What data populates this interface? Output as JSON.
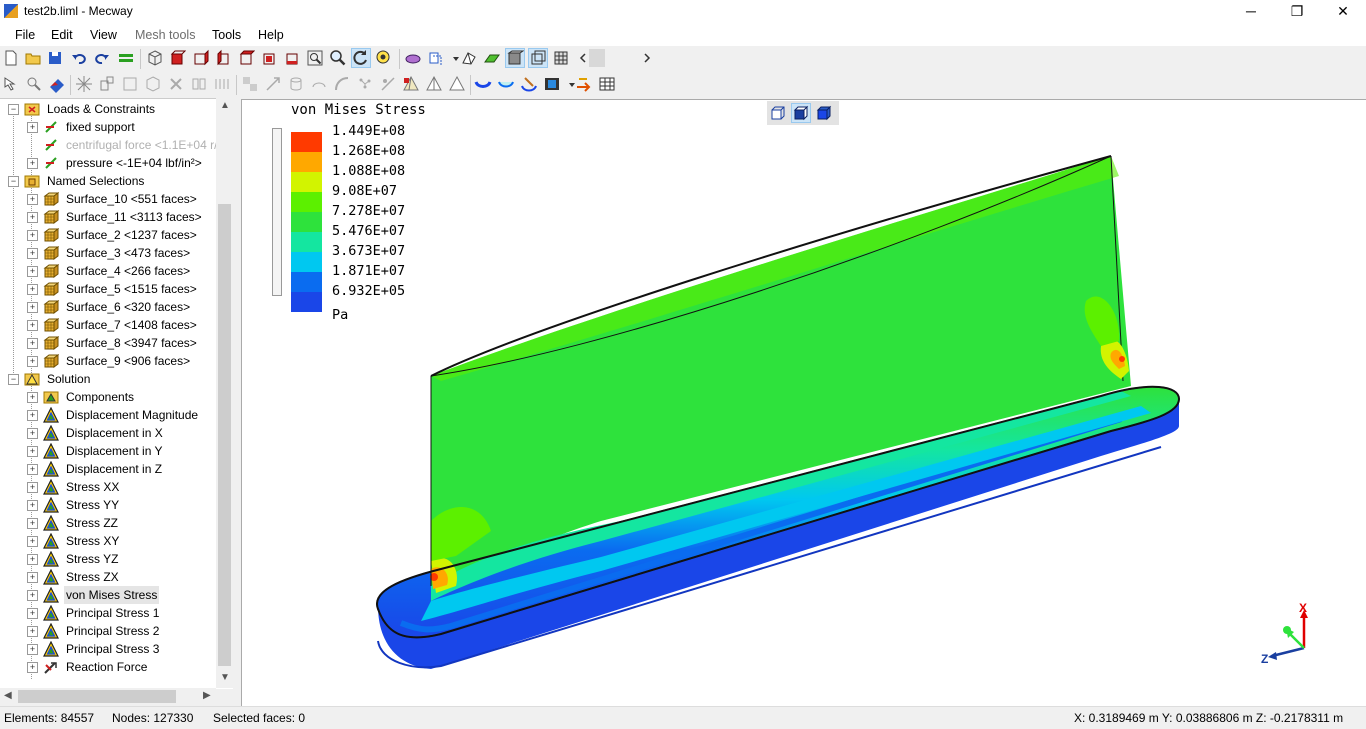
{
  "window": {
    "title": "test2b.liml - Mecway",
    "minimize": "─",
    "maximize": "❐",
    "close": "✕"
  },
  "menu": [
    {
      "label": "File",
      "enabled": true
    },
    {
      "label": "Edit",
      "enabled": true
    },
    {
      "label": "View",
      "enabled": true
    },
    {
      "label": "Mesh tools",
      "enabled": false
    },
    {
      "label": "Tools",
      "enabled": true
    },
    {
      "label": "Help",
      "enabled": true
    }
  ],
  "tree": {
    "items": [
      {
        "label": "Loads & Constraints",
        "icon": "loads-folder-icon",
        "level": 1,
        "expander": "−"
      },
      {
        "label": "fixed support",
        "icon": "fixed-support-icon",
        "level": 2,
        "expander": "+"
      },
      {
        "label": "centrifugal force <1.1E+04 r/",
        "icon": "centrifugal-force-icon",
        "level": 2,
        "expander": "",
        "dim": true
      },
      {
        "label": "pressure <-1E+04 lbf/in²>",
        "icon": "pressure-icon",
        "level": 2,
        "expander": "+"
      },
      {
        "label": "Named Selections",
        "icon": "named-selections-folder-icon",
        "level": 1,
        "expander": "−"
      },
      {
        "label": "Surface_10 <551 faces>",
        "icon": "named-selection-icon",
        "level": 2,
        "expander": "+"
      },
      {
        "label": "Surface_11 <3113 faces>",
        "icon": "named-selection-icon",
        "level": 2,
        "expander": "+"
      },
      {
        "label": "Surface_2 <1237 faces>",
        "icon": "named-selection-icon",
        "level": 2,
        "expander": "+"
      },
      {
        "label": "Surface_3 <473 faces>",
        "icon": "named-selection-icon",
        "level": 2,
        "expander": "+"
      },
      {
        "label": "Surface_4 <266 faces>",
        "icon": "named-selection-icon",
        "level": 2,
        "expander": "+"
      },
      {
        "label": "Surface_5 <1515 faces>",
        "icon": "named-selection-icon",
        "level": 2,
        "expander": "+"
      },
      {
        "label": "Surface_6 <320 faces>",
        "icon": "named-selection-icon",
        "level": 2,
        "expander": "+"
      },
      {
        "label": "Surface_7 <1408 faces>",
        "icon": "named-selection-icon",
        "level": 2,
        "expander": "+"
      },
      {
        "label": "Surface_8 <3947 faces>",
        "icon": "named-selection-icon",
        "level": 2,
        "expander": "+"
      },
      {
        "label": "Surface_9 <906 faces>",
        "icon": "named-selection-icon",
        "level": 2,
        "expander": "+"
      },
      {
        "label": "Solution",
        "icon": "solution-folder-icon",
        "level": 1,
        "expander": "−"
      },
      {
        "label": "Components",
        "icon": "components-icon",
        "level": 2,
        "expander": "+"
      },
      {
        "label": "Displacement Magnitude",
        "icon": "result-triangle-icon",
        "level": 2,
        "expander": "+"
      },
      {
        "label": "Displacement in X",
        "icon": "result-triangle-icon",
        "level": 2,
        "expander": "+"
      },
      {
        "label": "Displacement in Y",
        "icon": "result-triangle-icon",
        "level": 2,
        "expander": "+"
      },
      {
        "label": "Displacement in Z",
        "icon": "result-triangle-icon",
        "level": 2,
        "expander": "+"
      },
      {
        "label": "Stress XX",
        "icon": "result-triangle-icon",
        "level": 2,
        "expander": "+"
      },
      {
        "label": "Stress YY",
        "icon": "result-triangle-icon",
        "level": 2,
        "expander": "+"
      },
      {
        "label": "Stress ZZ",
        "icon": "result-triangle-icon",
        "level": 2,
        "expander": "+"
      },
      {
        "label": "Stress XY",
        "icon": "result-triangle-icon",
        "level": 2,
        "expander": "+"
      },
      {
        "label": "Stress YZ",
        "icon": "result-triangle-icon",
        "level": 2,
        "expander": "+"
      },
      {
        "label": "Stress ZX",
        "icon": "result-triangle-icon",
        "level": 2,
        "expander": "+"
      },
      {
        "label": "von Mises Stress",
        "icon": "result-triangle-icon",
        "level": 2,
        "expander": "+",
        "selected": true
      },
      {
        "label": "Principal Stress 1",
        "icon": "result-triangle-icon",
        "level": 2,
        "expander": "+"
      },
      {
        "label": "Principal Stress 2",
        "icon": "result-triangle-icon",
        "level": 2,
        "expander": "+"
      },
      {
        "label": "Principal Stress 3",
        "icon": "result-triangle-icon",
        "level": 2,
        "expander": "+"
      },
      {
        "label": "Reaction Force",
        "icon": "reaction-force-icon",
        "level": 2,
        "expander": "+"
      }
    ]
  },
  "viewport": {
    "legend": {
      "title": "von Mises Stress",
      "unit": "Pa",
      "values": [
        "1.449E+08",
        "1.268E+08",
        "1.088E+08",
        "9.08E+07",
        "7.278E+07",
        "5.476E+07",
        "3.673E+07",
        "1.871E+07",
        "6.932E+05"
      ],
      "colors": [
        "#ff3a00",
        "#ffa800",
        "#d2f400",
        "#5cf000",
        "#2ee23c",
        "#14e6a0",
        "#00c8f0",
        "#0a6cf0",
        "#1a46e8"
      ]
    },
    "axis_labels": {
      "x": "X",
      "z": "Z"
    }
  },
  "status": {
    "elements": "Elements: 84557",
    "nodes": "Nodes: 127330",
    "selected": "Selected faces: 0",
    "coords": "X: 0.3189469 m Y: 0.03886806 m Z: -0.2178311 m"
  }
}
